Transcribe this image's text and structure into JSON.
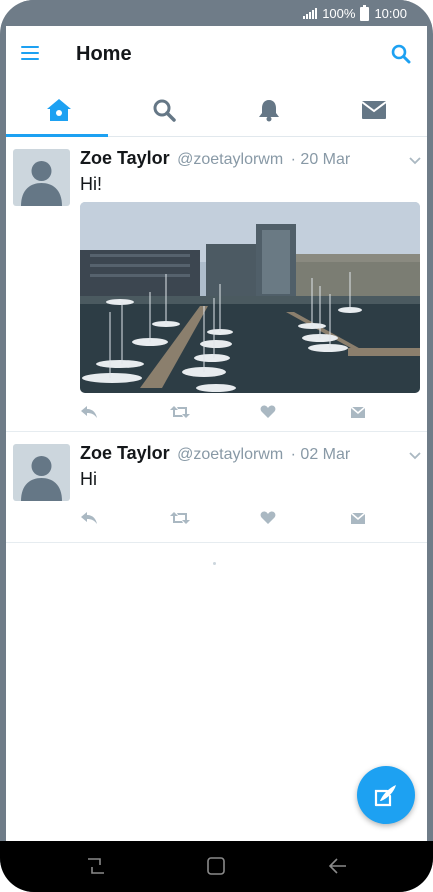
{
  "status": {
    "battery": "100%",
    "time": "10:00"
  },
  "header": {
    "title": "Home"
  },
  "tabs": [
    {
      "icon": "home-icon",
      "active": true
    },
    {
      "icon": "search-icon",
      "active": false
    },
    {
      "icon": "bell-icon",
      "active": false
    },
    {
      "icon": "envelope-icon",
      "active": false
    }
  ],
  "tweets": [
    {
      "name": "Zoe Taylor",
      "handle": "@zoetaylorwm",
      "date": "· 20 Mar",
      "text": "Hi!",
      "media": "harbour-photo"
    },
    {
      "name": "Zoe Taylor",
      "handle": "@zoetaylorwm",
      "date": "· 02 Mar",
      "text": "Hi"
    }
  ],
  "colors": {
    "accent": "#1da1f2",
    "statusbar": "#6f7c88",
    "icon_gray": "#aab8c2"
  }
}
